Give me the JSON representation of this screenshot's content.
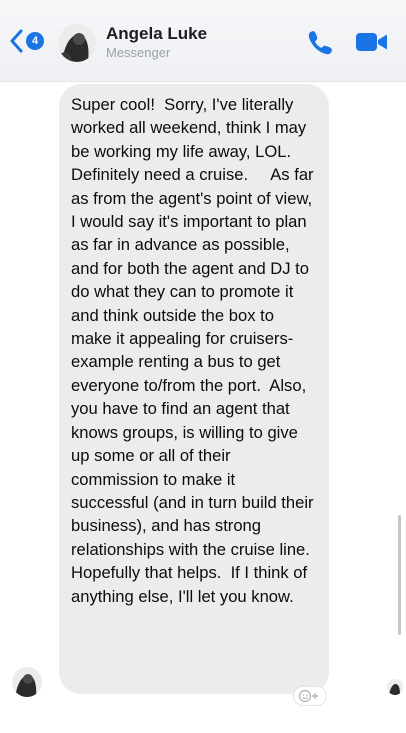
{
  "header": {
    "unread_count": "4",
    "contact_name": "Angela Luke",
    "contact_sub": "Messenger"
  },
  "message": {
    "text": "Super cool!  Sorry, I've literally worked all weekend, think I may be working my life away, LOL.  Definitely need a cruise.     As far as from the agent's point of view, I would say it's important to plan as far in advance as possible, and for both the agent and DJ to do what they can to promote it and think outside the box to make it appealing for cruisers- example renting a bus to get everyone to/from the port.  Also, you have to find an agent that knows groups, is willing to give up some or all of their commission to make it successful (and in turn build their business), and has strong relationships with the cruise line.  Hopefully that helps.  If I think of anything else, I'll let you know."
  },
  "icons": {
    "back": "chevron-left-icon",
    "call": "phone-icon",
    "video": "video-camera-icon",
    "react": "add-reaction-icon"
  },
  "colors": {
    "accent": "#1b74e4",
    "bubble": "#ececec"
  }
}
